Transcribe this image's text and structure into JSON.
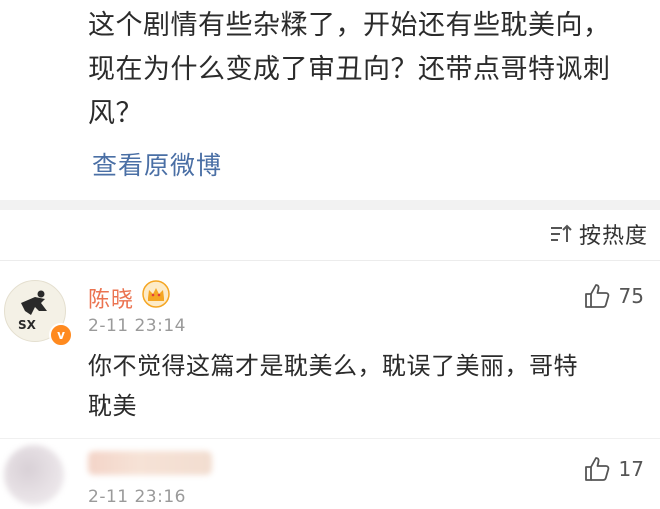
{
  "post": {
    "text_lines": [
      "这个剧情有些杂糅了，开始还有些耽美向，",
      "现在为什么变成了审丑向？还带点哥特讽刺",
      "风？"
    ],
    "view_original_label": "查看原微博"
  },
  "sort": {
    "icon": "sort-icon",
    "label": "按热度"
  },
  "comments": [
    {
      "username": "陈晓",
      "avatar_text": "SX",
      "verified": true,
      "verify_mark": "v",
      "badge_icon": "crown-icon",
      "timestamp": "2-11 23:14",
      "likes": "75",
      "text_lines": [
        "你不觉得这篇才是耽美么，耽误了美丽，哥特",
        "耽美"
      ]
    },
    {
      "username": "",
      "avatar_blurred": true,
      "timestamp": "2-11 23:16",
      "likes": "17"
    }
  ],
  "colors": {
    "link": "#4a6fa5",
    "username": "#eb7350",
    "verify_badge": "#ff8a1f",
    "crown": "#f5a623",
    "timestamp": "#9a9a9a",
    "divider_bg": "#f2f2f2"
  }
}
